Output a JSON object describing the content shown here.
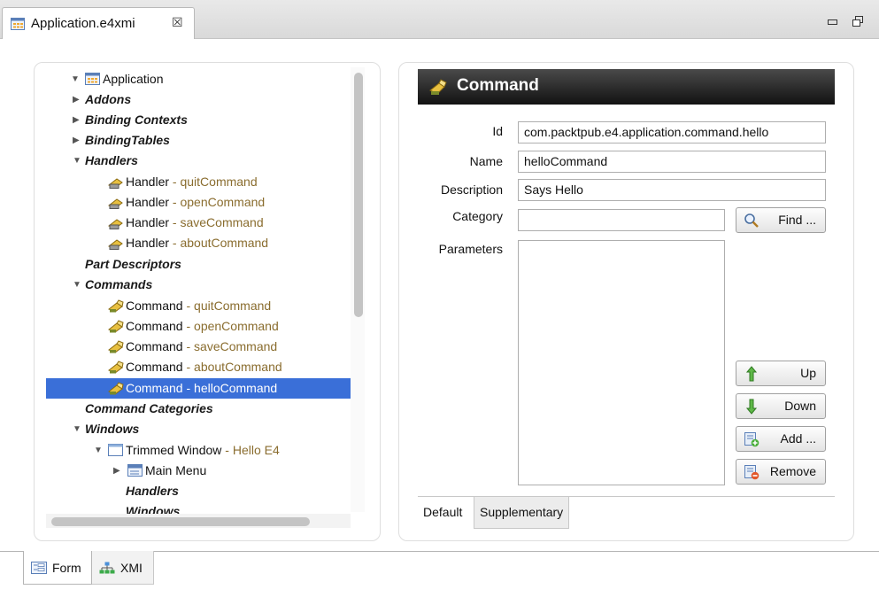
{
  "editor_tab": {
    "title": "Application.e4xmi",
    "close_glyph": "☒",
    "icon": "application-model-icon"
  },
  "window_controls": {
    "minimize": "▭",
    "maximize": "🗗"
  },
  "tree": [
    {
      "label": "Application",
      "suffix": "",
      "style": "normal",
      "twisty": "expanded",
      "icon": "application-icon"
    },
    {
      "label": "Addons",
      "suffix": "",
      "style": "italic",
      "twisty": "collapsed",
      "icon": ""
    },
    {
      "label": "Binding Contexts",
      "suffix": "",
      "style": "italic",
      "twisty": "collapsed",
      "icon": ""
    },
    {
      "label": "BindingTables",
      "suffix": "",
      "style": "italic",
      "twisty": "collapsed",
      "icon": ""
    },
    {
      "label": "Handlers",
      "suffix": "",
      "style": "italic",
      "twisty": "expanded",
      "icon": ""
    },
    {
      "label": "Handler",
      "suffix": " - quitCommand",
      "style": "normal",
      "twisty": "",
      "icon": "handler-icon"
    },
    {
      "label": "Handler",
      "suffix": " - openCommand",
      "style": "normal",
      "twisty": "",
      "icon": "handler-icon"
    },
    {
      "label": "Handler",
      "suffix": " - saveCommand",
      "style": "normal",
      "twisty": "",
      "icon": "handler-icon"
    },
    {
      "label": "Handler",
      "suffix": " - aboutCommand",
      "style": "normal",
      "twisty": "",
      "icon": "handler-icon"
    },
    {
      "label": "Part Descriptors",
      "suffix": "",
      "style": "italic",
      "twisty": "",
      "icon": ""
    },
    {
      "label": "Commands",
      "suffix": "",
      "style": "italic",
      "twisty": "expanded",
      "icon": ""
    },
    {
      "label": "Command",
      "suffix": " - quitCommand",
      "style": "normal",
      "twisty": "",
      "icon": "command-icon"
    },
    {
      "label": "Command",
      "suffix": " - openCommand",
      "style": "normal",
      "twisty": "",
      "icon": "command-icon"
    },
    {
      "label": "Command",
      "suffix": " - saveCommand",
      "style": "normal",
      "twisty": "",
      "icon": "command-icon"
    },
    {
      "label": "Command",
      "suffix": " - aboutCommand",
      "style": "normal",
      "twisty": "",
      "icon": "command-icon"
    },
    {
      "label": "Command",
      "suffix": " - helloCommand",
      "style": "normal",
      "twisty": "",
      "icon": "command-icon",
      "selected": true
    },
    {
      "label": "Command Categories",
      "suffix": "",
      "style": "italic",
      "twisty": "",
      "icon": ""
    },
    {
      "label": "Windows",
      "suffix": "",
      "style": "italic",
      "twisty": "expanded",
      "icon": ""
    },
    {
      "label": "Trimmed Window",
      "suffix": " - Hello E4",
      "style": "normal",
      "twisty": "expanded",
      "icon": "window-icon"
    },
    {
      "label": "Main Menu",
      "suffix": "",
      "style": "normal",
      "twisty": "collapsed",
      "icon": "menu-icon"
    },
    {
      "label": "Handlers",
      "suffix": "",
      "style": "italic",
      "twisty": "",
      "icon": ""
    },
    {
      "label": "Windows",
      "suffix": "",
      "style": "italic",
      "twisty": "",
      "icon": ""
    }
  ],
  "detail": {
    "title": "Command",
    "fields": {
      "id_label": "Id",
      "id_value": "com.packtpub.e4.application.command.hello",
      "name_label": "Name",
      "name_value": "helloCommand",
      "description_label": "Description",
      "description_value": "Says Hello",
      "category_label": "Category",
      "category_value": "",
      "parameters_label": "Parameters"
    },
    "buttons": {
      "find": "Find ...",
      "up": "Up",
      "down": "Down",
      "add": "Add ...",
      "remove": "Remove"
    },
    "subtabs": [
      "Default",
      "Supplementary"
    ]
  },
  "bottom_tabs": [
    "Form",
    "XMI"
  ],
  "colors": {
    "selection": "#3a6fd8",
    "suffix": "#8a6d2f",
    "header_dark": "#1a1a1a"
  }
}
